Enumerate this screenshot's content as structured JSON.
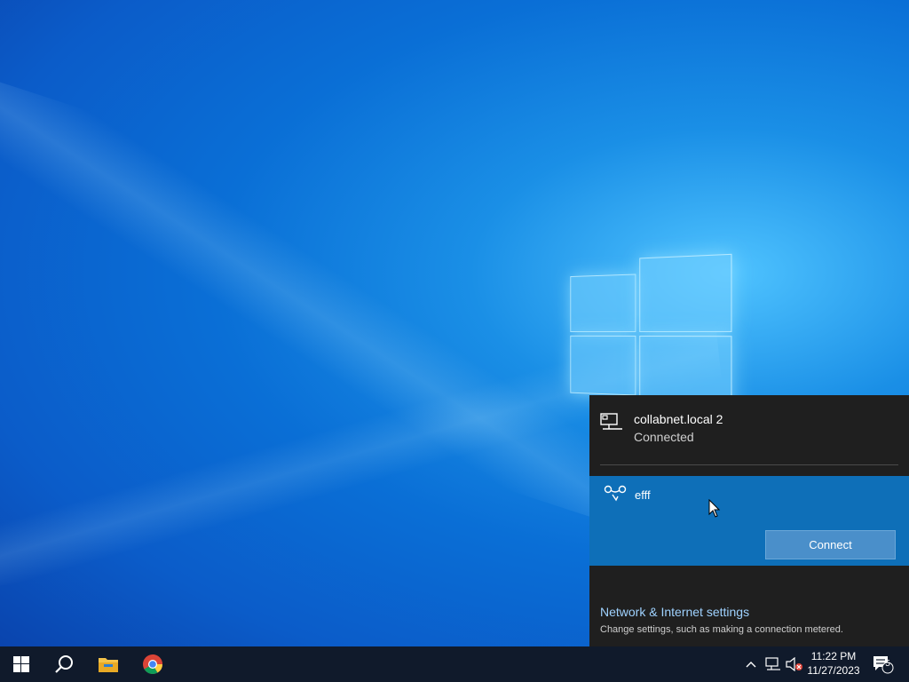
{
  "flyout": {
    "connection": {
      "name": "collabnet.local 2",
      "status": "Connected"
    },
    "wifi": {
      "name": "efff",
      "connect_label": "Connect"
    },
    "settings": {
      "title": "Network & Internet settings",
      "description": "Change settings, such as making a connection metered."
    }
  },
  "taskbar": {
    "apps": [
      "start-icon",
      "search-icon",
      "file-explorer-icon",
      "chrome-icon"
    ],
    "clock": {
      "time": "11:22 PM",
      "date": "11/27/2023"
    },
    "notification_count": "5"
  },
  "colors": {
    "flyout_bg": "#1f1f1f",
    "wifi_highlight": "#0e6fb8",
    "connect_button": "#4a8fca",
    "link": "#9fd2ff",
    "taskbar_bg": "#101a2b"
  }
}
